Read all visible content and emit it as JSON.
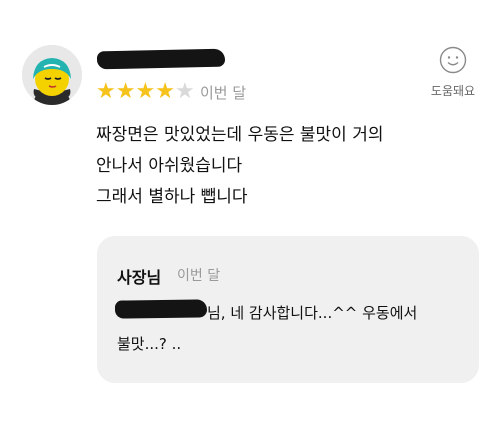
{
  "review": {
    "rating": 4,
    "rating_max": 5,
    "date": "이번 달",
    "lines": [
      "짜장면은 맛있었는데 우동은 불맛이 거의",
      "안나서 아쉬웠습니다",
      "그래서 별하나 뺍니다"
    ],
    "helpful_label": "도움돼요",
    "icons": {
      "helpful": "smiley-face-icon",
      "star_on": "star-filled-icon",
      "star_off": "star-empty-icon"
    }
  },
  "reply": {
    "author": "사장님",
    "date": "이번 달",
    "line1": "님, 네 감사합니다...^^ 우동에서",
    "line2": "불맛...? .."
  },
  "colors": {
    "star": "#f6c21c",
    "star_off": "#d9d9d9",
    "muted": "#9a9a9a",
    "reply_bg": "#f0f0f0"
  }
}
